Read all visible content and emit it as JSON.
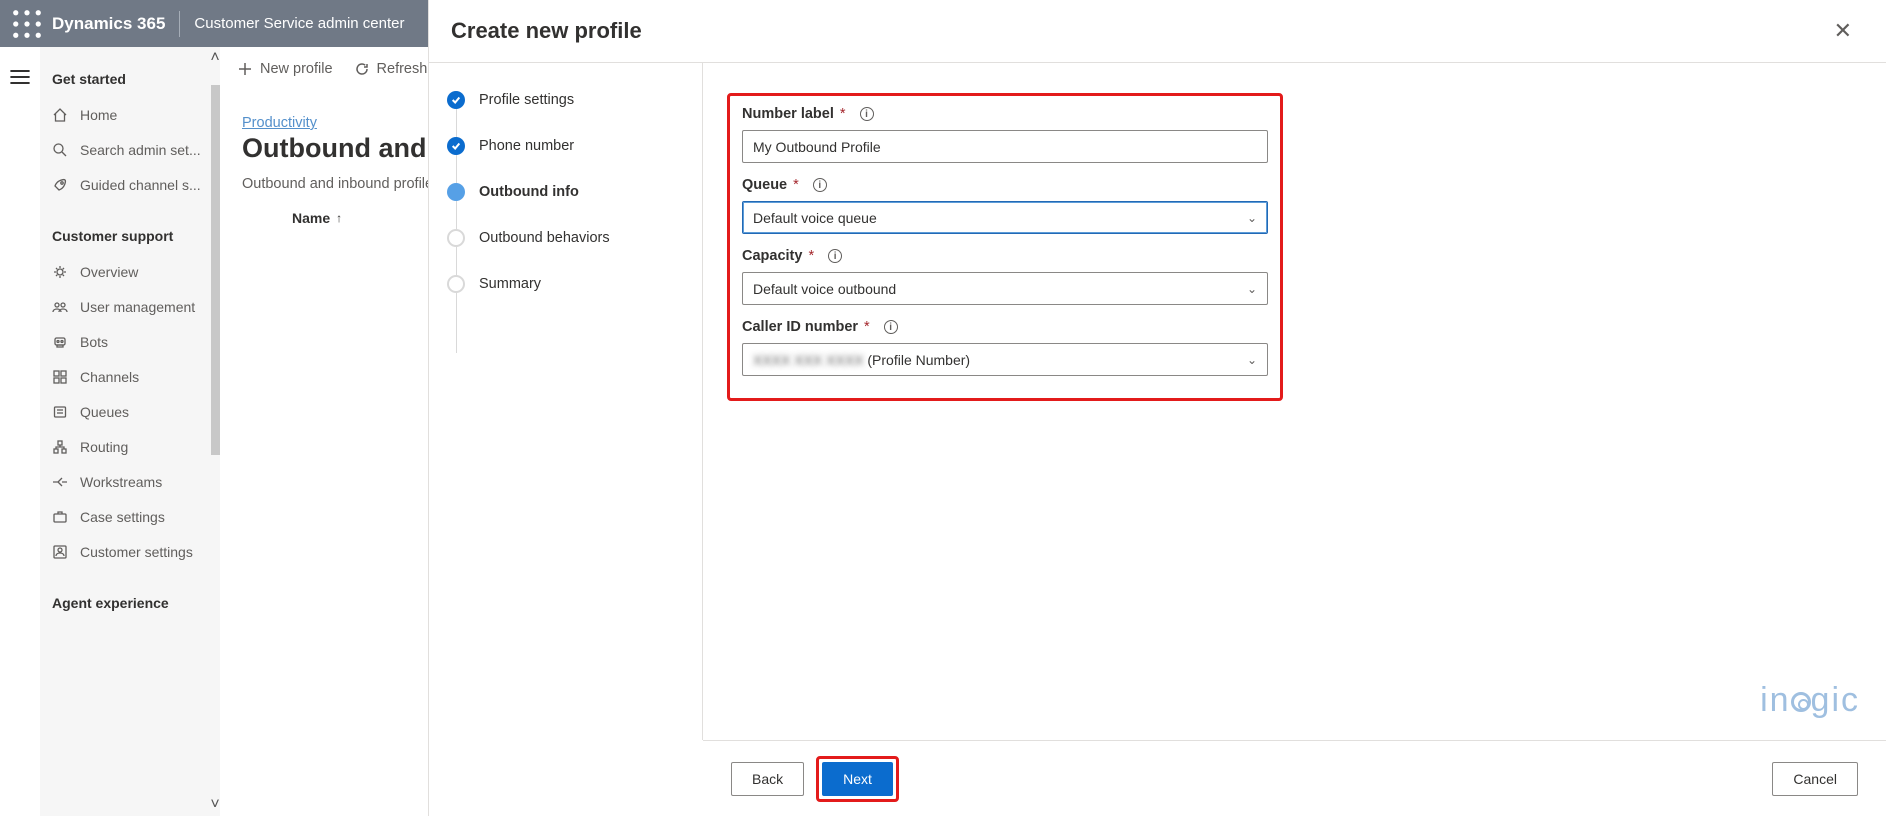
{
  "header": {
    "app_title": "Dynamics 365",
    "app_sub": "Customer Service admin center"
  },
  "cmdbar": {
    "new_profile": "New profile",
    "refresh": "Refresh"
  },
  "sidebar": {
    "groups": {
      "g0": "Get started",
      "g1": "Customer support",
      "g2": "Agent experience"
    },
    "items": {
      "home": "Home",
      "search": "Search admin set...",
      "guided": "Guided channel s...",
      "overview": "Overview",
      "user_mgmt": "User management",
      "bots": "Bots",
      "channels": "Channels",
      "queues": "Queues",
      "routing": "Routing",
      "workstreams": "Workstreams",
      "case_settings": "Case settings",
      "customer_settings": "Customer settings"
    }
  },
  "page": {
    "breadcrumb": "Productivity",
    "title": "Outbound and inb",
    "subtitle": "Outbound and inbound profiles a",
    "col_name": "Name"
  },
  "modal": {
    "title": "Create new profile",
    "steps": {
      "s1": "Profile settings",
      "s2": "Phone number",
      "s3": "Outbound info",
      "s4": "Outbound behaviors",
      "s5": "Summary"
    },
    "form": {
      "number_label_lbl": "Number label",
      "number_label_val": "My Outbound Profile",
      "queue_lbl": "Queue",
      "queue_val": "Default voice queue",
      "capacity_lbl": "Capacity",
      "capacity_val": "Default voice outbound",
      "callerid_lbl": "Caller ID number",
      "callerid_num": "XXXX XXX XXXX",
      "callerid_suffix": " (Profile Number)"
    },
    "footer": {
      "back": "Back",
      "next": "Next",
      "cancel": "Cancel"
    }
  },
  "logo": "inogic"
}
